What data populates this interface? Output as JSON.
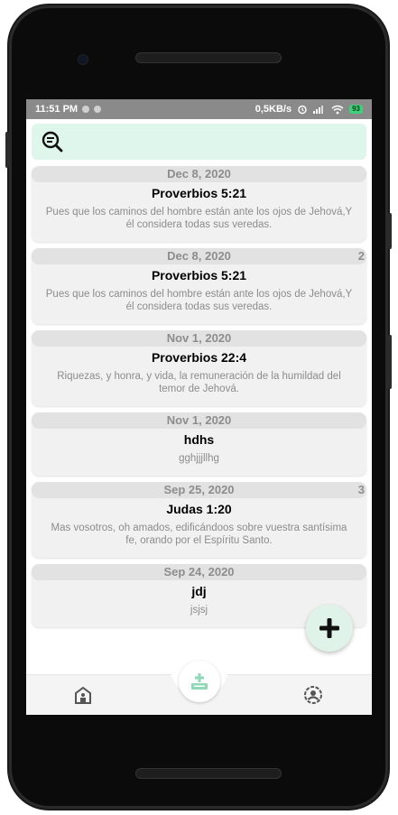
{
  "status_bar": {
    "time": "11:51 PM",
    "network_speed": "0,5KB/s",
    "battery": "93"
  },
  "search": {
    "icon": "search-list-icon"
  },
  "entries": [
    {
      "date": "Dec 8, 2020",
      "count": "",
      "reference": "Proverbios 5:21",
      "text": "Pues que los caminos del hombre están ante los ojos de Jehová,Y él considera todas sus veredas."
    },
    {
      "date": "Dec 8, 2020",
      "count": "2",
      "reference": "Proverbios 5:21",
      "text": "Pues que los caminos del hombre están ante los ojos de Jehová,Y él considera todas sus veredas."
    },
    {
      "date": "Nov 1, 2020",
      "count": "",
      "reference": "Proverbios 22:4",
      "text": "Riquezas, y honra, y vida, la remuneración de la humildad  del temor de Jehová."
    },
    {
      "date": "Nov 1, 2020",
      "count": "",
      "reference": "hdhs",
      "text": "gghjjjllhg"
    },
    {
      "date": "Sep 25, 2020",
      "count": "3",
      "reference": "Judas 1:20",
      "text": "Mas vosotros, oh amados, edificándoos sobre vuestra santísima fe, orando por el Espíritu Santo."
    },
    {
      "date": "Sep 24, 2020",
      "count": "",
      "reference": "jdj",
      "text": "jsjsj"
    }
  ],
  "fab": {
    "icon": "plus-icon"
  },
  "bottom_nav": {
    "left_icon": "home-icon",
    "center_icon": "download-tray-icon",
    "right_icon": "account-settings-icon"
  },
  "colors": {
    "accent": "#dff6ec",
    "icon_green": "#7fd3b0",
    "card_bg": "#f2f1f1",
    "date_bg": "#e2e2e2"
  }
}
